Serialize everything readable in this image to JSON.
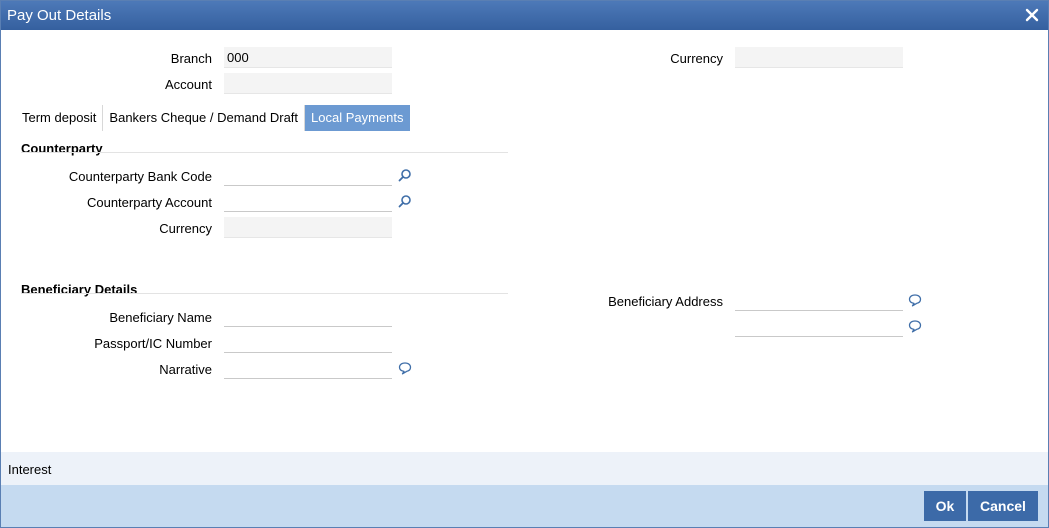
{
  "window": {
    "title": "Pay Out Details"
  },
  "header": {
    "branch_label": "Branch",
    "branch_value": "000",
    "account_label": "Account",
    "account_value": "",
    "currency_label": "Currency",
    "currency_value": ""
  },
  "tabs": [
    {
      "label": "Term deposit",
      "active": false
    },
    {
      "label": "Bankers Cheque / Demand Draft",
      "active": false
    },
    {
      "label": "Local Payments",
      "active": true
    }
  ],
  "counterparty": {
    "section_title": "Counterparty",
    "bank_code_label": "Counterparty Bank Code",
    "bank_code_value": "",
    "account_label": "Counterparty Account",
    "account_value": "",
    "currency_label": "Currency",
    "currency_value": ""
  },
  "beneficiary": {
    "section_title": "Beneficiary Details",
    "name_label": "Beneficiary Name",
    "name_value": "",
    "passport_label": "Passport/IC Number",
    "passport_value": "",
    "narrative_label": "Narrative",
    "narrative_value": "",
    "address_label": "Beneficiary Address",
    "address_line1": "",
    "address_line2": ""
  },
  "interest_label": "Interest",
  "buttons": {
    "ok": "Ok",
    "cancel": "Cancel"
  },
  "colors": {
    "title_bar": "#4d79b8",
    "active_tab": "#6c9ad2",
    "footer": "#c5daf0",
    "button": "#3c6aa8"
  },
  "icons": {
    "close": "close-icon",
    "lov": "search-icon",
    "narrative": "speech-bubble-icon"
  }
}
